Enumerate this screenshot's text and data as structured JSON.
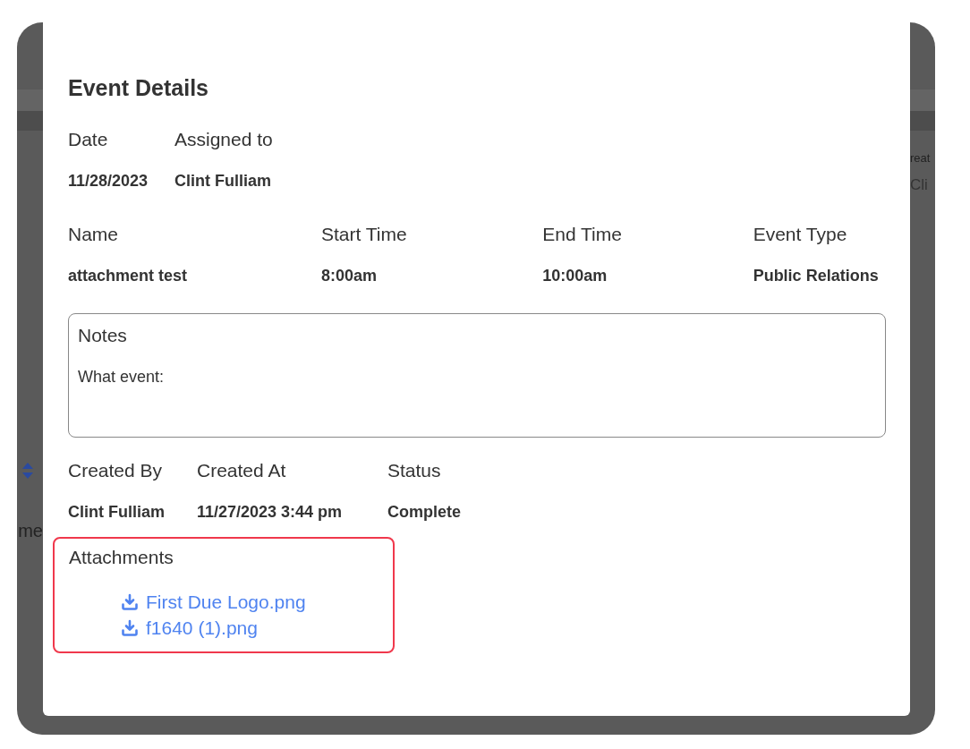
{
  "background_fragments": {
    "left_label": "me",
    "right_label": "reat",
    "right_value": "Cli"
  },
  "modal": {
    "title": "Event Details",
    "top_fields": [
      {
        "label": "Date",
        "value": "11/28/2023"
      },
      {
        "label": "Assigned to",
        "value": "Clint Fulliam"
      }
    ],
    "event_fields": [
      {
        "label": "Name",
        "value": "attachment test"
      },
      {
        "label": "Start Time",
        "value": "8:00am"
      },
      {
        "label": "End Time",
        "value": "10:00am"
      },
      {
        "label": "Event Type",
        "value": "Public Relations"
      }
    ],
    "notes": {
      "label": "Notes",
      "value": "What event:"
    },
    "meta_fields": [
      {
        "label": "Created By",
        "value": "Clint Fulliam"
      },
      {
        "label": "Created At",
        "value": "11/27/2023 3:44 pm"
      },
      {
        "label": "Status",
        "value": "Complete"
      }
    ],
    "attachments": {
      "label": "Attachments",
      "highlighted": true,
      "files": [
        "First Due Logo.png",
        "f1640 (1).png"
      ]
    }
  }
}
